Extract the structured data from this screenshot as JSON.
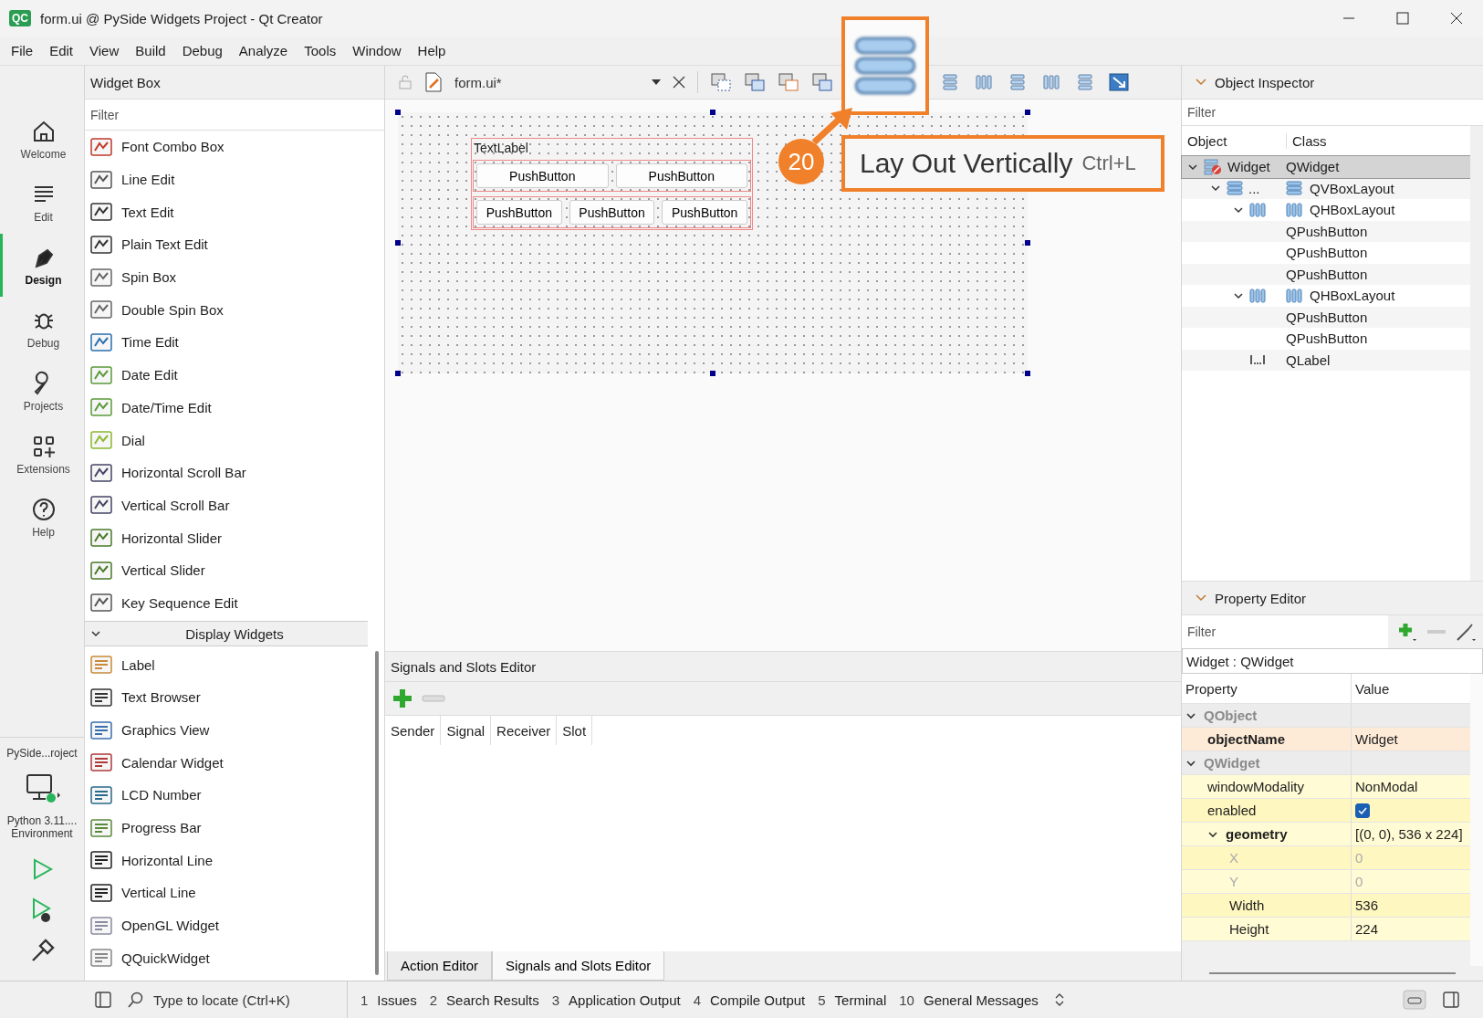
{
  "window": {
    "title": "form.ui @ PySide Widgets Project - Qt Creator",
    "badge": "QC"
  },
  "menu": [
    "File",
    "Edit",
    "View",
    "Build",
    "Debug",
    "Analyze",
    "Tools",
    "Window",
    "Help"
  ],
  "modes": [
    {
      "label": "Welcome",
      "kind": "home",
      "selected": false
    },
    {
      "label": "Edit",
      "kind": "edit",
      "selected": false
    },
    {
      "label": "Design",
      "kind": "design",
      "selected": true
    },
    {
      "label": "Debug",
      "kind": "debug",
      "selected": false
    },
    {
      "label": "Projects",
      "kind": "projects",
      "selected": false
    },
    {
      "label": "Extensions",
      "kind": "extensions",
      "selected": false
    },
    {
      "label": "Help",
      "kind": "help",
      "selected": false
    }
  ],
  "project": {
    "name": "PySide...roject",
    "kit": "Python 3.11....",
    "kit_detail": "Environment"
  },
  "widget_box": {
    "title": "Widget Box",
    "filter_placeholder": "Filter",
    "items": [
      "Font Combo Box",
      "Line Edit",
      "Text Edit",
      "Plain Text Edit",
      "Spin Box",
      "Double Spin Box",
      "Time Edit",
      "Date Edit",
      "Date/Time Edit",
      "Dial",
      "Horizontal Scroll Bar",
      "Vertical Scroll Bar",
      "Horizontal Slider",
      "Vertical Slider",
      "Key Sequence Edit"
    ],
    "section": {
      "label": "Display Widgets",
      "expanded": true,
      "items": [
        "Label",
        "Text Browser",
        "Graphics View",
        "Calendar Widget",
        "LCD Number",
        "Progress Bar",
        "Horizontal Line",
        "Vertical Line",
        "OpenGL Widget",
        "QQuickWidget"
      ]
    }
  },
  "editor": {
    "file": "form.ui*"
  },
  "form": {
    "label": "TextLabel",
    "layouts": [
      {
        "buttons": [
          "PushButton",
          "PushButton"
        ]
      },
      {
        "buttons": [
          "PushButton",
          "PushButton",
          "PushButton"
        ]
      }
    ]
  },
  "callout": {
    "number": "20",
    "tooltip": "Lay Out Vertically",
    "shortcut": "Ctrl+L"
  },
  "signals_editor": {
    "title": "Signals and Slots Editor",
    "columns": [
      "Sender",
      "Signal",
      "Receiver",
      "Slot"
    ]
  },
  "bottom_tabs": [
    {
      "label": "Action Editor",
      "selected": false
    },
    {
      "label": "Signals and Slots Editor",
      "selected": true
    }
  ],
  "object_inspector": {
    "title": "Object Inspector",
    "filter_placeholder": "Filter",
    "columns": [
      "Object",
      "Class"
    ],
    "tree": [
      {
        "object": "Widget",
        "class": "QWidget",
        "kind": "widget",
        "expanded": true,
        "selected": true,
        "children": [
          {
            "object": "...",
            "class": "QVBoxLayout",
            "kind": "vbox",
            "expanded": true,
            "selected": false,
            "children": [
              {
                "class": "QHBoxLayout",
                "kind": "hbox",
                "expanded": true,
                "selected": false,
                "children": [
                  {
                    "class": "QPushButton",
                    "selected": false
                  },
                  {
                    "class": "QPushButton",
                    "selected": false
                  },
                  {
                    "class": "QPushButton",
                    "selected": false
                  }
                ]
              },
              {
                "class": "QHBoxLayout",
                "kind": "hbox",
                "expanded": true,
                "selected": false,
                "children": [
                  {
                    "class": "QPushButton",
                    "selected": false
                  },
                  {
                    "class": "QPushButton",
                    "selected": false
                  }
                ]
              },
              {
                "class": "QLabel",
                "kind": "label",
                "selected": false
              }
            ]
          }
        ]
      }
    ]
  },
  "property_editor": {
    "title": "Property Editor",
    "filter_placeholder": "Filter",
    "object": "Widget : QWidget",
    "columns": [
      "Property",
      "Value"
    ],
    "rows": [
      {
        "kind": "group",
        "name": "QObject",
        "expanded": true,
        "children": [
          {
            "kind": "text",
            "name": "objectName",
            "value": "Widget",
            "bold": true
          }
        ]
      },
      {
        "kind": "group",
        "name": "QWidget",
        "expanded": true,
        "children": [
          {
            "kind": "text",
            "name": "windowModality",
            "value": "NonModal",
            "bold": false
          },
          {
            "kind": "check",
            "name": "enabled",
            "checked": true,
            "bold": false
          },
          {
            "kind": "text",
            "name": "geometry",
            "value": "[(0, 0), 536 x 224]",
            "bold": true,
            "expanded": true,
            "children": [
              {
                "kind": "text",
                "name": "X",
                "value": "0",
                "bold": false,
                "disabled": true
              },
              {
                "kind": "text",
                "name": "Y",
                "value": "0",
                "bold": false,
                "disabled": true
              },
              {
                "kind": "text",
                "name": "Width",
                "value": "536",
                "bold": false,
                "disabled": false
              },
              {
                "kind": "text",
                "name": "Height",
                "value": "224",
                "bold": false,
                "disabled": false
              }
            ]
          }
        ]
      }
    ]
  },
  "status_bar": {
    "locate_placeholder": "Type to locate (Ctrl+K)",
    "panes": [
      {
        "number": "1",
        "label": "Issues"
      },
      {
        "number": "2",
        "label": "Search Results"
      },
      {
        "number": "3",
        "label": "Application Output"
      },
      {
        "number": "4",
        "label": "Compile Output"
      },
      {
        "number": "5",
        "label": "Terminal"
      },
      {
        "number": "10",
        "label": "General Messages"
      }
    ]
  }
}
